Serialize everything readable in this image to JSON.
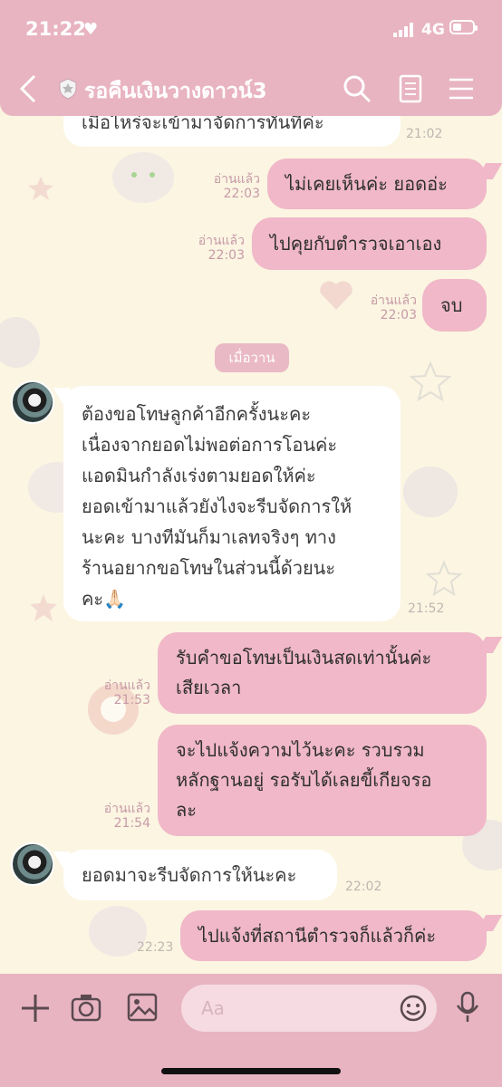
{
  "status": {
    "time": "21:22",
    "network": "4G"
  },
  "header": {
    "title": "รอคืนเงินวางดาวน์3"
  },
  "chat": {
    "day_divider": "เมื่อวาน",
    "messages": [
      {
        "text": "เมื่อไหร่จะเข้ามาจัดการทันทีค่ะ",
        "time": "21:02"
      },
      {
        "text": "ไม่เคยเห็นค่ะ ยอดอ่ะ",
        "read": "อ่านแล้ว",
        "time": "22:03"
      },
      {
        "text": "ไปคุยกับตำรวจเอาเอง",
        "read": "อ่านแล้ว",
        "time": "22:03"
      },
      {
        "text": "จบ",
        "read": "อ่านแล้ว",
        "time": "22:03"
      },
      {
        "lines": [
          "ต้องขอโทษลูกค้าอีกครั้งนะคะ",
          "เนื่องจากยอดไม่พอต่อการโอนค่ะ",
          "แอดมินกำลังเร่งตามยอดให้ค่ะ",
          "ยอดเข้ามาแล้วยังไงจะรีบจัดการให้",
          "นะคะ บางทีมันก็มาเลทจริงๆ ทาง",
          "ร้านอยากขอโทษในส่วนนี้ด้วยนะ",
          "คะ🙏🏻"
        ],
        "time": "21:52"
      },
      {
        "lines": [
          "รับคำขอโทษเป็นเงินสดเท่านั้นค่ะ",
          "เสียเวลา"
        ],
        "read": "อ่านแล้ว",
        "time": "21:53"
      },
      {
        "lines": [
          "จะไปแจ้งความไว้นะคะ รวบรวม",
          "หลักฐานอยู่ รอรับได้เลยขี้เกียจรอ",
          "ละ"
        ],
        "read": "อ่านแล้ว",
        "time": "21:54"
      },
      {
        "text": "ยอดมาจะรีบจัดการให้นะคะ",
        "time": "22:02"
      },
      {
        "text": "ไปแจ้งที่สถานีตำรวจก็แล้วก็ค่ะ",
        "time": "22:23"
      }
    ]
  },
  "composer": {
    "placeholder": "Aa"
  },
  "colors": {
    "header": "#e8b4c2",
    "bubble_out": "#f0b8c8",
    "bubble_in": "#ffffff",
    "background": "#fbf5e2"
  },
  "icons": [
    "back-icon",
    "shield-icon",
    "search-icon",
    "notes-icon",
    "menu-icon",
    "plus-icon",
    "camera-icon",
    "image-icon",
    "emoji-icon",
    "mic-icon"
  ]
}
